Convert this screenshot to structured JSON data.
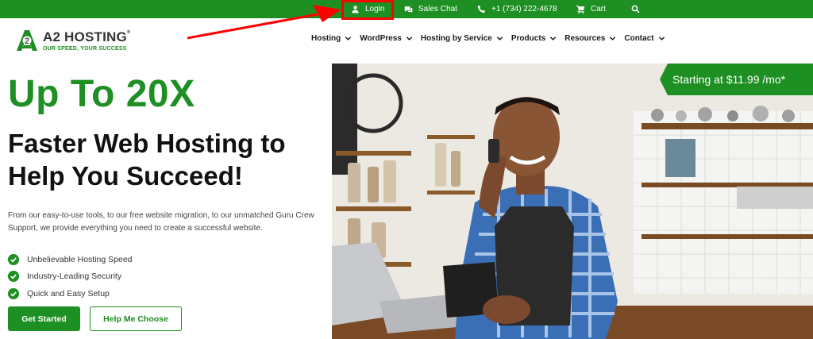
{
  "topbar": {
    "login": "Login",
    "sales_chat": "Sales Chat",
    "phone": "+1 (734) 222-4678",
    "cart": "Cart"
  },
  "logo": {
    "name": "A2 HOSTING",
    "registered": "®",
    "tagline": "OUR SPEED, YOUR SUCCESS"
  },
  "nav": {
    "items": [
      {
        "label": "Hosting"
      },
      {
        "label": "WordPress"
      },
      {
        "label": "Hosting by Service"
      },
      {
        "label": "Products"
      },
      {
        "label": "Resources"
      },
      {
        "label": "Contact"
      }
    ]
  },
  "hero": {
    "headline": "Up To 20X",
    "subheadline_line1": "Faster Web Hosting to",
    "subheadline_line2": "Help You Succeed!",
    "lead": "From our easy-to-use tools, to our free website migration, to our unmatched Guru Crew Support, we provide everything you need to create a successful website.",
    "features": [
      "Unbelievable Hosting Speed",
      "Industry-Leading Security",
      "Quick and Easy Setup"
    ],
    "cta_primary": "Get Started",
    "cta_secondary": "Help Me Choose",
    "price_badge": "Starting at $11.99 /mo*"
  },
  "colors": {
    "brand_green": "#1e8f23",
    "annotation_red": "#ff0000"
  }
}
